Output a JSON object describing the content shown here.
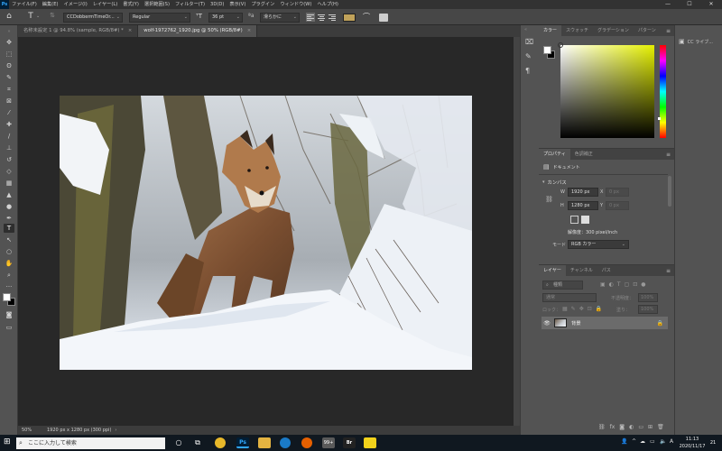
{
  "app": {
    "logo": "Ps"
  },
  "menu": [
    "ファイル(F)",
    "編集(E)",
    "イメージ(I)",
    "レイヤー(L)",
    "書式(Y)",
    "選択範囲(S)",
    "フィルター(T)",
    "3D(D)",
    "表示(V)",
    "プラグイン",
    "ウィンドウ(W)",
    "ヘルプ(H)"
  ],
  "window_controls": {
    "minimize": "—",
    "maximize": "☐",
    "close": "✕"
  },
  "options": {
    "font_family": "CCDobbermTimeOr...",
    "font_style": "Regular",
    "font_size": "36 pt",
    "antialias": "滑らかに",
    "text_color": "#c0a25a"
  },
  "tabs": [
    {
      "label": "名称未設定 1 @ 94.8% (sample, RGB/8#) *",
      "close": "×"
    },
    {
      "label": "wolf-1972762_1920.jpg @ 50% (RGB/8#)",
      "close": "×"
    }
  ],
  "status": {
    "zoom": "50%",
    "doc_size": "1920 px x 1280 px (300 ppi)"
  },
  "color_panel": {
    "tabs": [
      "カラー",
      "スウォッチ",
      "グラデーション",
      "パターン"
    ],
    "foreground": "#ffffff",
    "background": "#000000",
    "hue": "#e5f000"
  },
  "right_dock": {
    "label": "CC ライブ..."
  },
  "properties": {
    "tabs": [
      "プロパティ",
      "色調補正"
    ],
    "doc_label": "ドキュメント",
    "canvas_label": "カンバス",
    "w_label": "W",
    "w_value": "1920 px",
    "h_label": "H",
    "h_value": "1280 px",
    "x_label": "X",
    "x_value": "0 px",
    "y_label": "Y",
    "y_value": "0 px",
    "resolution": "解像度：300 pixel/inch",
    "mode_label": "モード",
    "mode_value": "RGB カラー"
  },
  "layers": {
    "tabs": [
      "レイヤー",
      "チャンネル",
      "パス"
    ],
    "search_placeholder": "種類",
    "blend_mode": "通常",
    "opacity_label": "不透明度：",
    "opacity": "100%",
    "lock_label": "ロック：",
    "fill_label": "塗り：",
    "fill": "100%",
    "items": [
      {
        "name": "背景"
      }
    ]
  },
  "taskbar": {
    "search_placeholder": "ここに入力して検索",
    "time": "11:13",
    "date": "2020/11/17",
    "ime": "A",
    "notification_count": "21",
    "badge": "99+"
  }
}
